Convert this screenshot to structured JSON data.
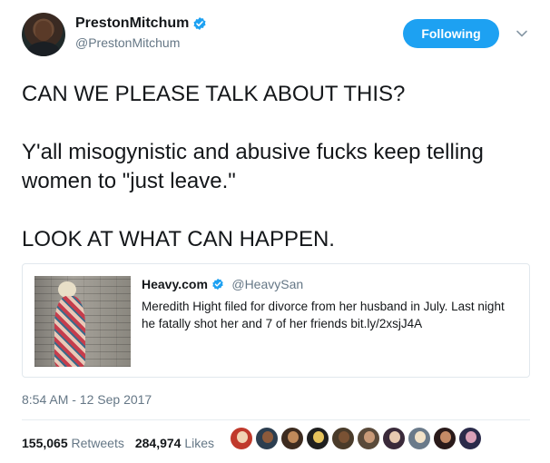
{
  "user": {
    "display_name": "PrestonMitchum",
    "handle": "@PrestonMitchum",
    "follow_label": "Following",
    "accent_color": "#1da1f2"
  },
  "tweet": {
    "text": "CAN WE PLEASE TALK ABOUT THIS?\n\nY'all misogynistic and abusive fucks keep telling women to \"just leave.\"\n\nLOOK AT WHAT CAN HAPPEN.",
    "timestamp": "8:54 AM - 12 Sep 2017"
  },
  "quote": {
    "name": "Heavy.com",
    "handle": "@HeavySan",
    "text": "Meredith Hight filed for divorce from her husband in July. Last night he fatally shot her and 7 of her friends bit.ly/2xsjJ4A"
  },
  "stats": {
    "retweets_count": "155,065",
    "retweets_label": "Retweets",
    "likes_count": "284,974",
    "likes_label": "Likes"
  },
  "likers": [
    {
      "bg": "#c0392b",
      "face": "#f1d3b3"
    },
    {
      "bg": "#2c3e50",
      "face": "#8d5a3b"
    },
    {
      "bg": "#3d2b1f",
      "face": "#c08a5b"
    },
    {
      "bg": "#1f1f1f",
      "face": "#e6c35c"
    },
    {
      "bg": "#4a3b2a",
      "face": "#7a5234"
    },
    {
      "bg": "#5a4a3a",
      "face": "#c99a78"
    },
    {
      "bg": "#3a2a3a",
      "face": "#e7c9b0"
    },
    {
      "bg": "#6a7a8a",
      "face": "#f2e2c8"
    },
    {
      "bg": "#2a1a1a",
      "face": "#c48a66"
    },
    {
      "bg": "#2a2a4a",
      "face": "#d9a0b8"
    }
  ]
}
